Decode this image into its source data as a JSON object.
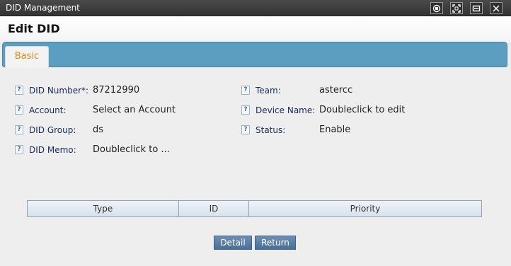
{
  "window": {
    "title": "DID Management"
  },
  "header": {
    "title": "Edit DID"
  },
  "tabs": [
    {
      "label": "Basic"
    }
  ],
  "help_glyph": "?",
  "fields_left": [
    {
      "label": "DID Number*:",
      "value": "87212990"
    },
    {
      "label": "Account:",
      "value": "Select an Account"
    },
    {
      "label": "DID Group:",
      "value": "ds"
    },
    {
      "label": "DID Memo:",
      "value": "Doubleclick to ..."
    }
  ],
  "fields_right": [
    {
      "label": "Team:",
      "value": "astercc"
    },
    {
      "label": "Device Name:",
      "value": "Doubleclick to edit"
    },
    {
      "label": "Status:",
      "value": "Enable"
    }
  ],
  "table": {
    "columns": [
      "Type",
      "ID",
      "Priority"
    ]
  },
  "buttons": {
    "detail": "Detail",
    "return": "Return"
  },
  "icons": {
    "window_controls": [
      "restore-icon",
      "maximize-icon",
      "minimize-icon",
      "close-icon"
    ],
    "field_help": "help-icon"
  },
  "colors": {
    "titlebar": "#3a3a3a",
    "tabbar": "#5c9ec0",
    "tab_label": "#d58a18",
    "button": "#5a7ea6"
  }
}
